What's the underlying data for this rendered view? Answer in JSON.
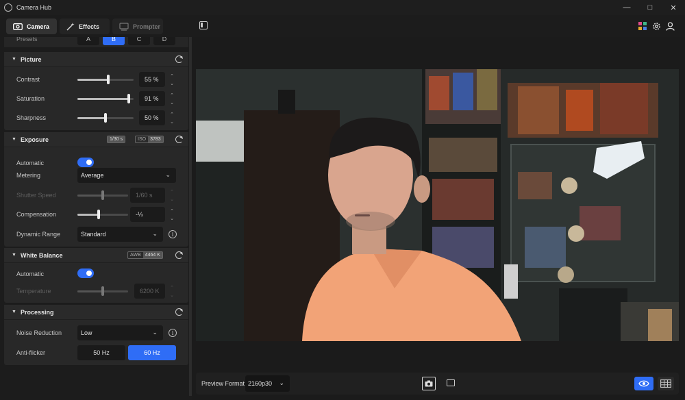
{
  "window": {
    "title": "Camera Hub",
    "controls": [
      "minimize",
      "maximize",
      "close"
    ]
  },
  "tabs": [
    {
      "label": "Camera",
      "icon": "camera-icon",
      "active": true
    },
    {
      "label": "Effects",
      "icon": "magic-wand-icon",
      "active": false
    },
    {
      "label": "Prompter",
      "icon": "prompter-icon",
      "active": false,
      "disabled": true
    }
  ],
  "header_icons": [
    "sidebar-toggle-icon",
    "elgato-apps-icon",
    "gear-icon",
    "user-icon"
  ],
  "presets": {
    "label": "Presets",
    "options": [
      "A",
      "B",
      "C",
      "D"
    ],
    "selected": "B"
  },
  "picture": {
    "title": "Picture",
    "rows": [
      {
        "label": "Contrast",
        "value": "55 %",
        "level": 0.55
      },
      {
        "label": "Saturation",
        "value": "91 %",
        "level": 0.91
      },
      {
        "label": "Sharpness",
        "value": "50 %",
        "level": 0.5
      }
    ]
  },
  "exposure": {
    "title": "Exposure",
    "badge_shutter": "1/30 s",
    "badge_iso_label": "ISO",
    "badge_iso_value": "3783",
    "automatic_label": "Automatic",
    "automatic_on": true,
    "metering_label": "Metering",
    "metering_value": "Average",
    "shutter_label": "Shutter Speed",
    "shutter_value": "1/60 s",
    "shutter_level": 0.5,
    "compensation_label": "Compensation",
    "compensation_value": "-⅓",
    "compensation_level": 0.42,
    "dynamic_range_label": "Dynamic Range",
    "dynamic_range_value": "Standard"
  },
  "white_balance": {
    "title": "White Balance",
    "badge_label": "AWB",
    "badge_value": "4464 K",
    "automatic_label": "Automatic",
    "automatic_on": true,
    "temperature_label": "Temperature",
    "temperature_value": "6200 K",
    "temperature_level": 0.5
  },
  "processing": {
    "title": "Processing",
    "noise_label": "Noise Reduction",
    "noise_value": "Low",
    "antiflicker_label": "Anti-flicker",
    "antiflicker_options": [
      "50 Hz",
      "60 Hz"
    ],
    "antiflicker_selected": "60 Hz"
  },
  "bottom": {
    "preview_format_label": "Preview Format",
    "preview_format_value": "2160p30"
  },
  "colors": {
    "accent": "#2f6df6",
    "background": "#1b1b1b",
    "panel": "#282828"
  }
}
